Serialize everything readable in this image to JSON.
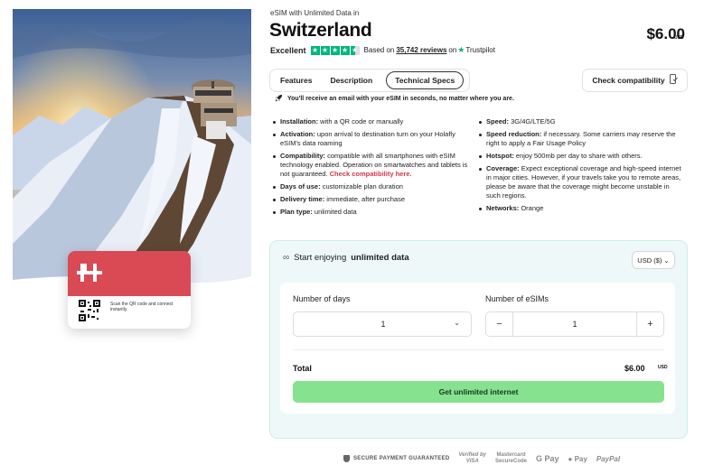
{
  "hero": {
    "card_text": "Scan the QR code and connect instantly.",
    "card_color": "#d94a55"
  },
  "header": {
    "eyebrow": "eSIM with Unlimited Data in",
    "title": "Switzerland",
    "price": "$6.00",
    "currency": "USD"
  },
  "rating": {
    "label": "Excellent",
    "stars": 4.5,
    "based_on": "Based on",
    "count": "35,742 reviews",
    "on": "on",
    "provider": "Trustpilot",
    "accent": "#00b67a"
  },
  "tabs": [
    {
      "label": "Features",
      "active": false
    },
    {
      "label": "Description",
      "active": false
    },
    {
      "label": "Technical Specs",
      "active": true
    }
  ],
  "check_compatibility": {
    "label": "Check compatibility",
    "icon": "phone-check-icon"
  },
  "email_note": "You'll receive an email with your eSIM in seconds, no matter where you are.",
  "specs_left": [
    {
      "title": "Installation:",
      "text": " with a QR code or manually"
    },
    {
      "title": "Activation:",
      "text": " upon arrival to destination turn on your Holafly eSIM's data roaming"
    },
    {
      "title": "Compatibility:",
      "text": " compatible with all smartphones with eSIM technology enabled. Operation on smartwatches and tablets is not guaranteed. ",
      "link": "Check compatibility here."
    },
    {
      "title": "Days of use:",
      "text": " customizable plan duration"
    },
    {
      "title": "Delivery time:",
      "text": " immediate, after purchase"
    },
    {
      "title": "Plan type:",
      "text": " unlimited data"
    }
  ],
  "specs_right": [
    {
      "title": "Speed:",
      "text": " 3G/4G/LTE/5G"
    },
    {
      "title": "Speed reduction:",
      "text": " if necessary. Some carriers may reserve the right to apply a Fair Usage Policy"
    },
    {
      "title": "Hotspot:",
      "text": " enjoy 500mb per day to share with others."
    },
    {
      "title": "Coverage:",
      "text": " Expect exceptional coverage and high-speed internet in major cities. However, if your travels take you to remote areas, please be aware that the coverage might become unstable in such regions."
    },
    {
      "title": "Networks:",
      "text": " Orange"
    }
  ],
  "panel": {
    "heading_prefix": "Start enjoying",
    "heading_bold": "unlimited data",
    "currency_select": "USD ($)",
    "days_label": "Number of days",
    "days_value": "1",
    "esims_label": "Number of eSIMs",
    "esims_value": "1",
    "minus": "−",
    "plus": "+",
    "total_label": "Total",
    "total_value": "$6.00",
    "total_currency": "USD",
    "cta": "Get unlimited internet",
    "cta_color": "#86e28f"
  },
  "footer": {
    "secure": "SECURE PAYMENT GUARANTEED",
    "verified_by": "Verified by",
    "visa": "VISA",
    "mastercard": "Mastercard",
    "securecode": "SecureCode",
    "gpay": "G Pay",
    "apay": " Pay",
    "paypal": "PayPal"
  }
}
